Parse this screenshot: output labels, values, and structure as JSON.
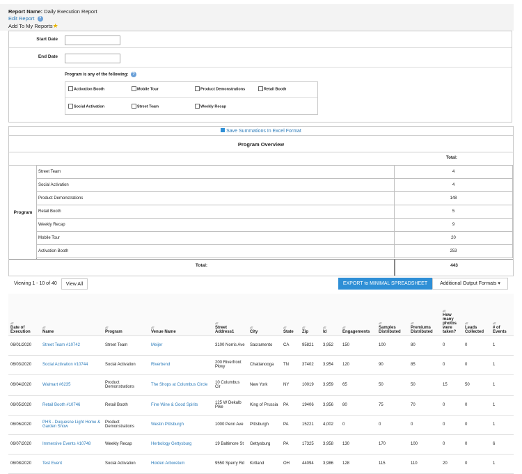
{
  "report": {
    "name_label": "Report Name:",
    "name_value": "Daily Execution Report",
    "edit_link": "Edit Report",
    "add_to_reports": "Add To My Reports"
  },
  "filters": {
    "start_date_label": "Start Date",
    "end_date_label": "End Date",
    "start_date_value": "",
    "end_date_value": "",
    "program_label": "Program is any of the following:",
    "programs": [
      "Activation Booth",
      "Mobile Tour",
      "Product Demonstrations",
      "Retail Booth",
      "Social Activation",
      "Street Team",
      "Weekly Recap"
    ]
  },
  "summary": {
    "save_link": "Save Summations In Excel Format",
    "title": "Program Overview",
    "total_header": "Total:",
    "group_label": "Program",
    "rows": [
      {
        "label": "Street Team",
        "total": "4"
      },
      {
        "label": "Social Activation",
        "total": "4"
      },
      {
        "label": "Product Demonstrations",
        "total": "148"
      },
      {
        "label": "Retail Booth",
        "total": "5"
      },
      {
        "label": "Weekly Recap",
        "total": "9"
      },
      {
        "label": "Mobile Tour",
        "total": "20"
      },
      {
        "label": "Activation Booth",
        "total": "253"
      }
    ],
    "grand_total_label": "Total:",
    "grand_total": "443"
  },
  "pager": {
    "viewing": "Viewing 1 - 10 of 40",
    "view_all": "View All",
    "export_button": "EXPORT to MINIMAL SPREADSHEET",
    "additional_formats": "Additional Output Formats"
  },
  "grid": {
    "columns": [
      "Date of Execution",
      "Name",
      "Program",
      "Venue Name",
      "Street Address1",
      "City",
      "State",
      "Zip",
      "Id",
      "Engagements",
      "Samples Distributed",
      "Premiums Distributed",
      "How many photos were taken?",
      "Leads Collected",
      "# of Events"
    ],
    "rows": [
      [
        "06/01/2020",
        "Street Team #10742",
        "Street Team",
        "Meijer",
        "3100 Norris Ave",
        "Sacramento",
        "CA",
        "95821",
        "3,952",
        "150",
        "100",
        "80",
        "0",
        "0",
        "1"
      ],
      [
        "06/03/2020",
        "Social Activation #10744",
        "Social Activation",
        "Riverbend",
        "200 Riverfront Pkwy",
        "Chattanooga",
        "TN",
        "37402",
        "3,954",
        "120",
        "90",
        "85",
        "0",
        "0",
        "1"
      ],
      [
        "06/04/2020",
        "Walmart #6235",
        "Product Demonstrations",
        "The Shops at Columbus Circle",
        "10 Columbus Cir",
        "New York",
        "NY",
        "10019",
        "3,959",
        "65",
        "50",
        "50",
        "15",
        "50",
        "1"
      ],
      [
        "06/05/2020",
        "Retail Booth #10746",
        "Retail Booth",
        "Fine Wine & Good Spirits",
        "125 W Dekalb Pike",
        "King of Prussia",
        "PA",
        "19406",
        "3,956",
        "80",
        "75",
        "70",
        "0",
        "0",
        "1"
      ],
      [
        "06/06/2020",
        "PHS - Duquesne Light Home & Garden Show",
        "Product Demonstrations",
        "Westin Pittsburgh",
        "1000 Penn Ave",
        "Pittsburgh",
        "PA",
        "15221",
        "4,002",
        "0",
        "0",
        "0",
        "0",
        "0",
        "1"
      ],
      [
        "06/07/2020",
        "Immersive Events #10748",
        "Weekly Recap",
        "Herbology Gettysburg",
        "19 Baltimore St",
        "Gettysburg",
        "PA",
        "17325",
        "3,958",
        "130",
        "170",
        "100",
        "0",
        "0",
        "6"
      ],
      [
        "06/08/2020",
        "Test Event",
        "Social Activation",
        "Holden Arboretum",
        "9550 Sperry Rd",
        "Kirtland",
        "OH",
        "44094",
        "3,986",
        "128",
        "115",
        "110",
        "20",
        "0",
        "1"
      ]
    ]
  },
  "colors": {
    "link": "#2a7ab9",
    "accent_button": "#2e8fd6",
    "header_bg": "#f3f3f3"
  }
}
